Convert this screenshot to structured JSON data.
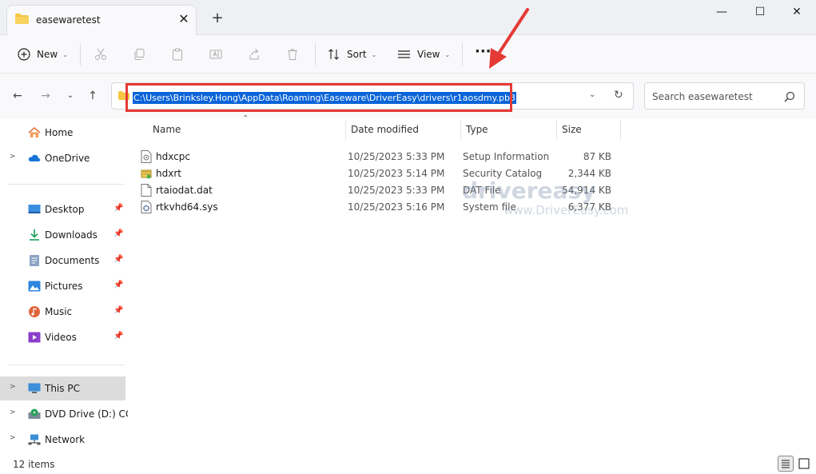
{
  "tab": {
    "title": "easewaretest",
    "close": "✕"
  },
  "newtab": "+",
  "window": {
    "minimize": "—",
    "maximize": "☐",
    "close": "✕"
  },
  "toolbar": {
    "new_label": "New",
    "sort_label": "Sort",
    "view_label": "View",
    "more_label": "···"
  },
  "address": {
    "path": "C:\\Users\\Brinksley.Hong\\AppData\\Roaming\\Easeware\\DriverEasy\\drivers\\r1aosdmy.pb3"
  },
  "search": {
    "placeholder": "Search easewaretest"
  },
  "sidebar": {
    "items": [
      {
        "label": "Home",
        "icon": "home-icon"
      },
      {
        "label": "OneDrive",
        "icon": "cloud-icon"
      },
      {
        "label": "Desktop",
        "icon": "desktop-icon",
        "pinned": true
      },
      {
        "label": "Downloads",
        "icon": "download-icon",
        "pinned": true
      },
      {
        "label": "Documents",
        "icon": "documents-icon",
        "pinned": true
      },
      {
        "label": "Pictures",
        "icon": "pictures-icon",
        "pinned": true
      },
      {
        "label": "Music",
        "icon": "music-icon",
        "pinned": true
      },
      {
        "label": "Videos",
        "icon": "videos-icon",
        "pinned": true
      },
      {
        "label": "This PC",
        "icon": "pc-icon",
        "selected": true
      },
      {
        "label": "DVD Drive (D:) CCC",
        "icon": "dvd-icon"
      },
      {
        "label": "Network",
        "icon": "network-icon"
      }
    ]
  },
  "columns": {
    "name": "Name",
    "date": "Date modified",
    "type": "Type",
    "size": "Size"
  },
  "files": [
    {
      "name": "hdxcpc",
      "date": "10/25/2023 5:33 PM",
      "type": "Setup Information",
      "size": "87 KB",
      "icon": "setup-info-icon"
    },
    {
      "name": "hdxrt",
      "date": "10/25/2023 5:14 PM",
      "type": "Security Catalog",
      "size": "2,344 KB",
      "icon": "security-catalog-icon"
    },
    {
      "name": "rtaiodat.dat",
      "date": "10/25/2023 5:33 PM",
      "type": "DAT File",
      "size": "54,914 KB",
      "icon": "file-icon"
    },
    {
      "name": "rtkvhd64.sys",
      "date": "10/25/2023 5:16 PM",
      "type": "System file",
      "size": "6,377 KB",
      "icon": "system-file-icon"
    }
  ],
  "watermark": {
    "logo": "drivereasy",
    "url": "www.DriverEasy.com"
  },
  "status": {
    "items": "12 items"
  },
  "colors": {
    "accent": "#0a64d8",
    "highlight_box": "#e53935",
    "arrow": "#e53935"
  }
}
